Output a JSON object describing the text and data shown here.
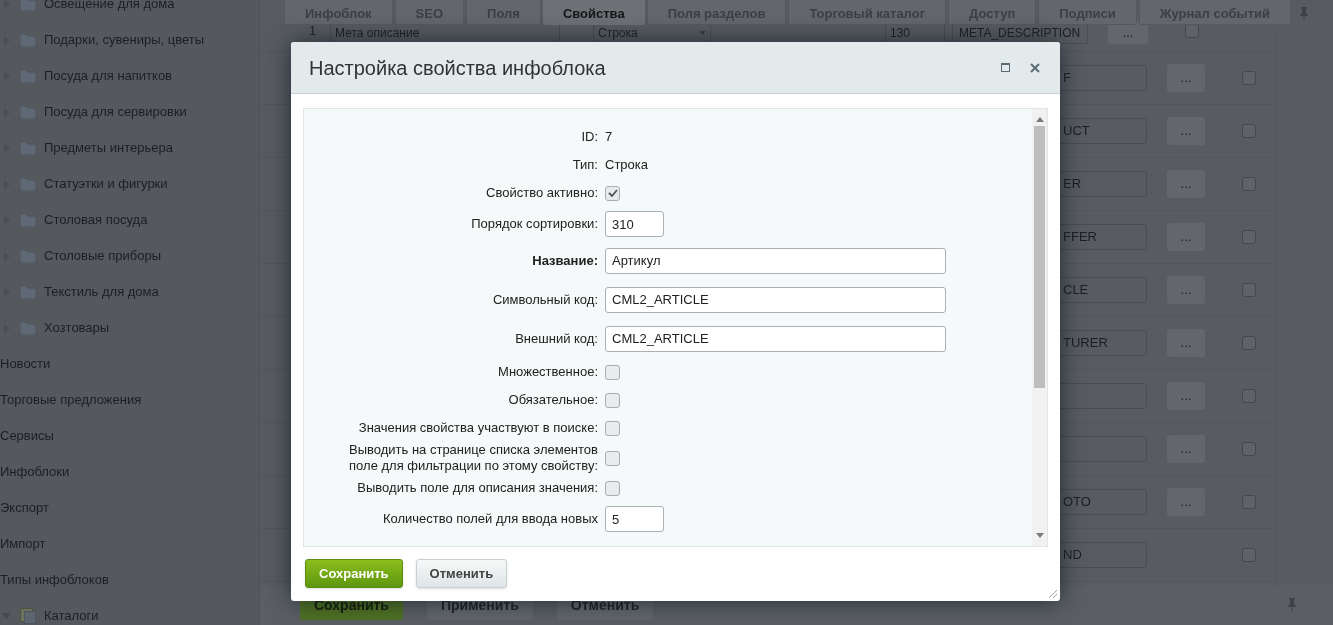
{
  "sidebar": {
    "items": [
      {
        "label": "Освещение для дома",
        "kind": "folder",
        "expanded": false
      },
      {
        "label": "Подарки, сувениры, цветы",
        "kind": "folder",
        "expanded": false
      },
      {
        "label": "Посуда для напитков",
        "kind": "folder",
        "expanded": false
      },
      {
        "label": "Посуда для сервировки",
        "kind": "folder",
        "expanded": false
      },
      {
        "label": "Предметы интерьера",
        "kind": "folder",
        "expanded": false
      },
      {
        "label": "Статуэтки и фигурки",
        "kind": "folder",
        "expanded": false
      },
      {
        "label": "Столовая посуда",
        "kind": "folder",
        "expanded": false
      },
      {
        "label": "Столовые приборы",
        "kind": "folder",
        "expanded": false
      },
      {
        "label": "Текстиль для дома",
        "kind": "folder",
        "expanded": false
      },
      {
        "label": "Хозтовары",
        "kind": "folder",
        "expanded": false
      },
      {
        "label": "Новости",
        "kind": "link"
      },
      {
        "label": "Торговые предложения",
        "kind": "link"
      },
      {
        "label": "Сервисы",
        "kind": "link"
      },
      {
        "label": "Инфоблоки",
        "kind": "link"
      },
      {
        "label": "Экспорт",
        "kind": "link"
      },
      {
        "label": "Импорт",
        "kind": "link"
      },
      {
        "label": "Типы инфоблоков",
        "kind": "link"
      },
      {
        "label": "Каталоги",
        "kind": "catalog",
        "expanded": true
      }
    ]
  },
  "tabs": [
    {
      "label": "Инфоблок",
      "selected": false
    },
    {
      "label": "SEO",
      "selected": false
    },
    {
      "label": "Поля",
      "selected": false
    },
    {
      "label": "Свойства",
      "selected": true
    },
    {
      "label": "Поля разделов",
      "selected": false
    },
    {
      "label": "Торговый каталог",
      "selected": false
    },
    {
      "label": "Доступ",
      "selected": false
    },
    {
      "label": "Подписи",
      "selected": false
    },
    {
      "label": "Журнал событий",
      "selected": false
    }
  ],
  "table": {
    "first_row": {
      "column_1": "1",
      "column_2": "Мета описание",
      "column_3": "Строка",
      "column_4": "130",
      "column_5": "META_DESCRIPTION",
      "button": "...",
      "checked": false
    },
    "rows": [
      {
        "code": "F",
        "button": "...",
        "checked": false
      },
      {
        "code": "UCT",
        "button": "...",
        "checked": false
      },
      {
        "code": "ER",
        "button": "...",
        "checked": false
      },
      {
        "code": "FFER",
        "button": "...",
        "checked": false
      },
      {
        "code": "CLE",
        "button": "...",
        "checked": false
      },
      {
        "code": "TURER",
        "button": "...",
        "checked": false
      },
      {
        "code": "",
        "button": "...",
        "checked": false
      },
      {
        "code": "",
        "button": "...",
        "checked": false
      },
      {
        "code": "OTO",
        "button": "...",
        "checked": false
      },
      {
        "code": "ND",
        "checked": false
      }
    ]
  },
  "form_buttons": [
    "Сохранить",
    "Применить",
    "Отменить"
  ],
  "dialog": {
    "title": "Настройка свойства инфоблока",
    "rows": [
      {
        "kind": "text",
        "label": "ID:",
        "value": "7"
      },
      {
        "kind": "text",
        "label": "Тип:",
        "value": "Строка"
      },
      {
        "kind": "checkbox",
        "label": "Свойство активно:",
        "checked": true
      },
      {
        "kind": "short_input",
        "label": "Порядок сортировки:",
        "value": "310"
      },
      {
        "kind": "input",
        "label": "Название:",
        "value": "Артикул",
        "required": true
      },
      {
        "kind": "input",
        "label": "Символьный код:",
        "value": "CML2_ARTICLE"
      },
      {
        "kind": "input",
        "label": "Внешний код:",
        "value": "CML2_ARTICLE"
      },
      {
        "kind": "checkbox",
        "label": "Множественное:",
        "checked": false
      },
      {
        "kind": "checkbox",
        "label": "Обязательное:",
        "checked": false
      },
      {
        "kind": "checkbox",
        "label": "Значения свойства участвуют в поиске:",
        "checked": false
      },
      {
        "kind": "checkbox",
        "label": "Выводить на странице списка элементов поле для фильтрации по этому свойству:",
        "checked": false
      },
      {
        "kind": "checkbox",
        "label": "Выводить поле для описания значения:",
        "checked": false
      },
      {
        "kind": "short_input",
        "label": "Количество полей для ввода новых",
        "value": "5"
      }
    ],
    "buttons": [
      {
        "label": "Сохранить",
        "kind": "primary"
      },
      {
        "label": "Отменить",
        "kind": "secondary"
      }
    ]
  }
}
